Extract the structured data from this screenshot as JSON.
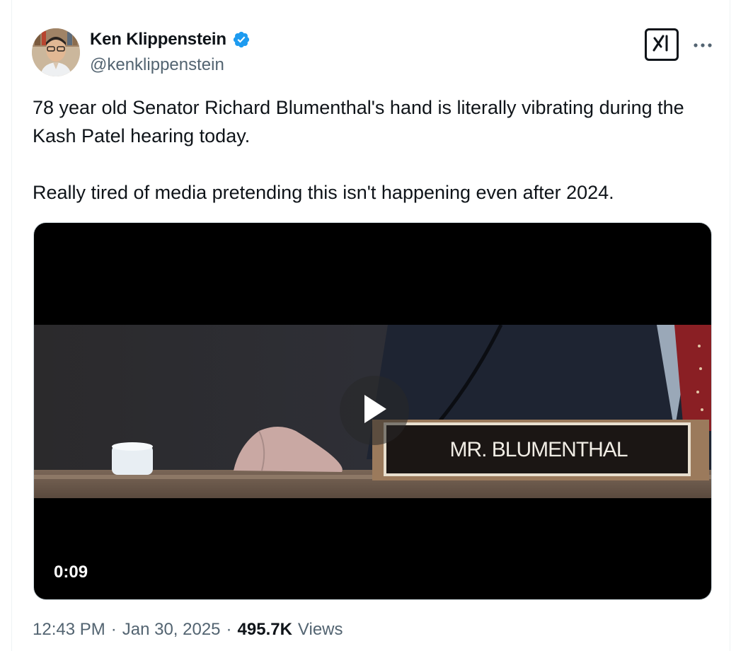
{
  "author": {
    "name": "Ken Klippenstein",
    "handle": "@kenklippenstein",
    "verified": true,
    "verified_color": "#1d9bf0"
  },
  "tweet": {
    "paragraphs": [
      "78 year old Senator Richard Blumenthal's hand is literally vibrating during the Kash Patel hearing today.",
      "Really tired of media pretending this isn't happening even after 2024."
    ]
  },
  "video": {
    "duration": "0:09",
    "nameplate": "MR. BLUMENTHAL"
  },
  "meta": {
    "time": "12:43 PM",
    "separator": "·",
    "date": "Jan 30, 2025",
    "views_count": "495.7K",
    "views_label": "Views"
  },
  "icons": {
    "grok": "grok-icon",
    "more": "more-icon",
    "play": "play-icon",
    "verified": "verified-badge-icon"
  },
  "colors": {
    "text": "#0f1419",
    "secondary": "#536471",
    "border": "#cfd9de"
  }
}
